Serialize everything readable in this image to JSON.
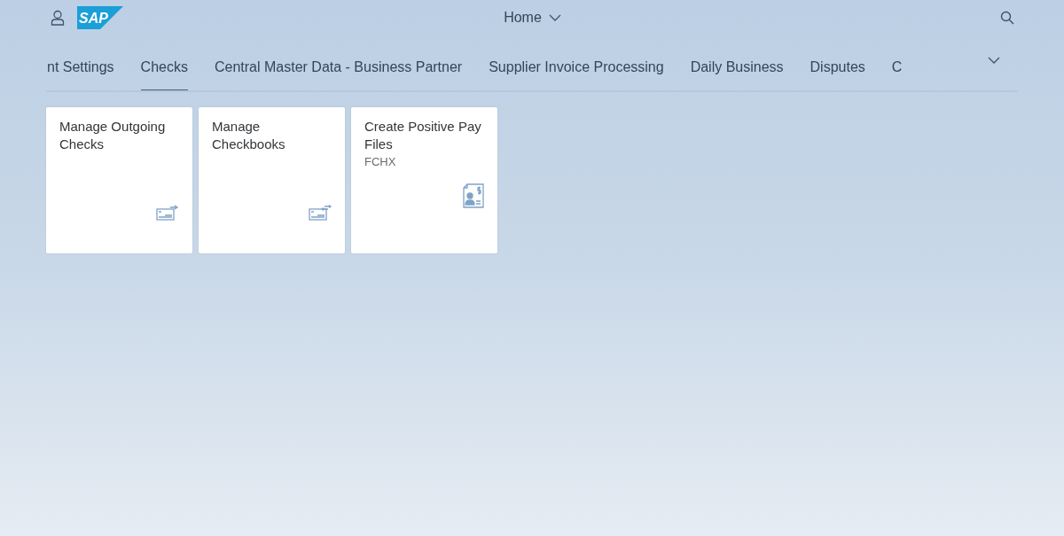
{
  "header": {
    "logo": "SAP",
    "title": "Home"
  },
  "tabs": [
    {
      "label": "nt Settings",
      "selected": false
    },
    {
      "label": "Checks",
      "selected": true
    },
    {
      "label": "Central Master Data - Business Partner",
      "selected": false
    },
    {
      "label": "Supplier Invoice Processing",
      "selected": false
    },
    {
      "label": "Daily Business",
      "selected": false
    },
    {
      "label": "Disputes",
      "selected": false
    },
    {
      "label": "C",
      "selected": false
    }
  ],
  "tiles": [
    {
      "title": "Manage Outgoing Checks",
      "kind": "outgoing"
    },
    {
      "title": "Manage Checkbooks",
      "kind": "checkbook"
    },
    {
      "title": "Create Positive Pay Files",
      "subtitle": "FCHX",
      "kind": "document"
    }
  ]
}
